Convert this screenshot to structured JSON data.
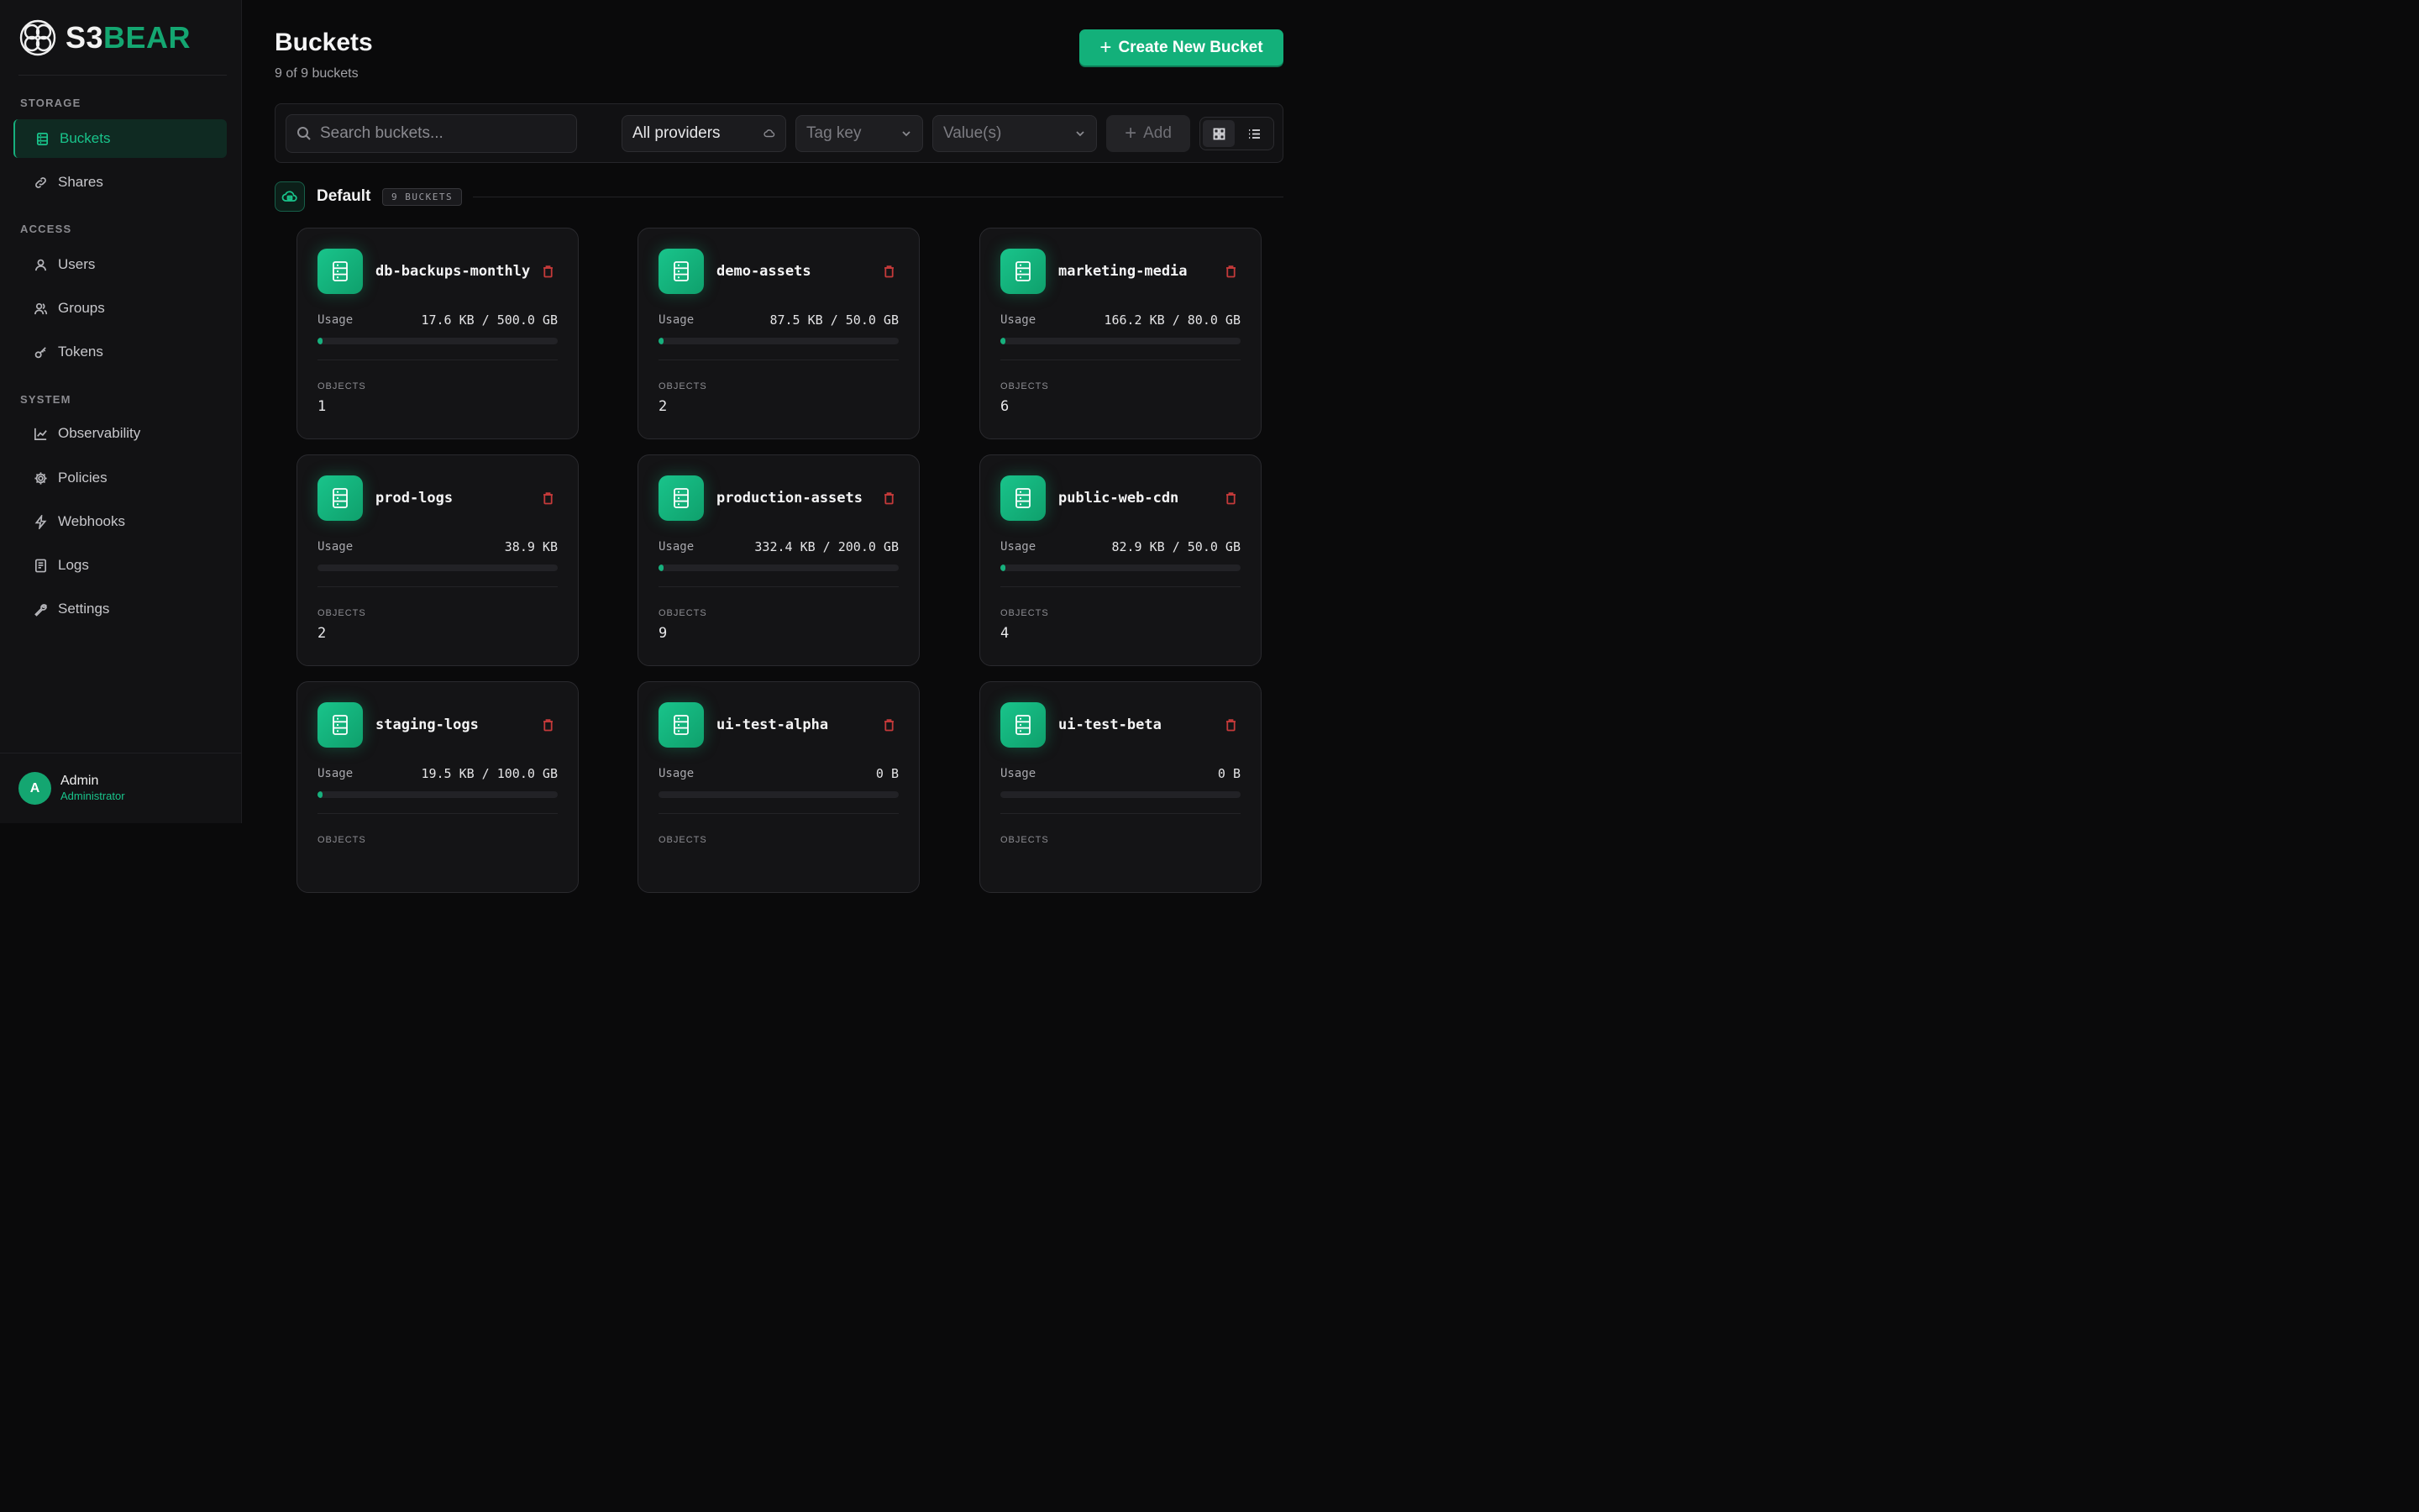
{
  "brand": {
    "prefix": "S3",
    "suffix": "BEAR"
  },
  "sidebar": {
    "sections": [
      {
        "title": "STORAGE",
        "items": [
          {
            "label": "Buckets",
            "icon": "server-icon",
            "active": true
          },
          {
            "label": "Shares",
            "icon": "link-icon",
            "active": false
          }
        ]
      },
      {
        "title": "ACCESS",
        "items": [
          {
            "label": "Users",
            "icon": "user-icon",
            "active": false
          },
          {
            "label": "Groups",
            "icon": "users-icon",
            "active": false
          },
          {
            "label": "Tokens",
            "icon": "key-icon",
            "active": false
          }
        ]
      },
      {
        "title": "SYSTEM",
        "items": [
          {
            "label": "Observability",
            "icon": "chart-line-icon",
            "active": false
          },
          {
            "label": "Policies",
            "icon": "gear-icon",
            "active": false
          },
          {
            "label": "Webhooks",
            "icon": "bolt-icon",
            "active": false
          },
          {
            "label": "Logs",
            "icon": "file-text-icon",
            "active": false
          },
          {
            "label": "Settings",
            "icon": "wrench-icon",
            "active": false
          }
        ]
      }
    ],
    "user": {
      "initial": "A",
      "name": "Admin",
      "role": "Administrator"
    }
  },
  "header": {
    "title": "Buckets",
    "subtitle": "9 of 9 buckets",
    "create_label": "Create New Bucket"
  },
  "filters": {
    "search_placeholder": "Search buckets...",
    "provider": "All providers",
    "tag_key": "Tag key",
    "values": "Value(s)",
    "add_label": "Add",
    "view": "grid"
  },
  "group": {
    "name": "Default",
    "badge": "9 BUCKETS"
  },
  "buckets": [
    {
      "name": "db-backups-monthly",
      "usage": "17.6 KB / 500.0 GB",
      "usage_fraction": 0.01,
      "objects_label": "OBJECTS",
      "objects": "1"
    },
    {
      "name": "demo-assets",
      "usage": "87.5 KB / 50.0 GB",
      "usage_fraction": 0.01,
      "objects_label": "OBJECTS",
      "objects": "2"
    },
    {
      "name": "marketing-media",
      "usage": "166.2 KB / 80.0 GB",
      "usage_fraction": 0.01,
      "objects_label": "OBJECTS",
      "objects": "6"
    },
    {
      "name": "prod-logs",
      "usage": "38.9 KB",
      "usage_fraction": 0,
      "objects_label": "OBJECTS",
      "objects": "2"
    },
    {
      "name": "production-assets",
      "usage": "332.4 KB / 200.0 GB",
      "usage_fraction": 0.01,
      "objects_label": "OBJECTS",
      "objects": "9"
    },
    {
      "name": "public-web-cdn",
      "usage": "82.9 KB / 50.0 GB",
      "usage_fraction": 0.01,
      "objects_label": "OBJECTS",
      "objects": "4"
    },
    {
      "name": "staging-logs",
      "usage": "19.5 KB / 100.0 GB",
      "usage_fraction": 0.01,
      "objects_label": "OBJECTS",
      "objects": ""
    },
    {
      "name": "ui-test-alpha",
      "usage": "0 B",
      "usage_fraction": 0,
      "objects_label": "OBJECTS",
      "objects": ""
    },
    {
      "name": "ui-test-beta",
      "usage": "0 B",
      "usage_fraction": 0,
      "objects_label": "OBJECTS",
      "objects": ""
    }
  ],
  "labels": {
    "usage": "Usage"
  },
  "colors": {
    "accent": "#14a671",
    "danger": "#c43a3a",
    "background": "#0a0a0b"
  }
}
